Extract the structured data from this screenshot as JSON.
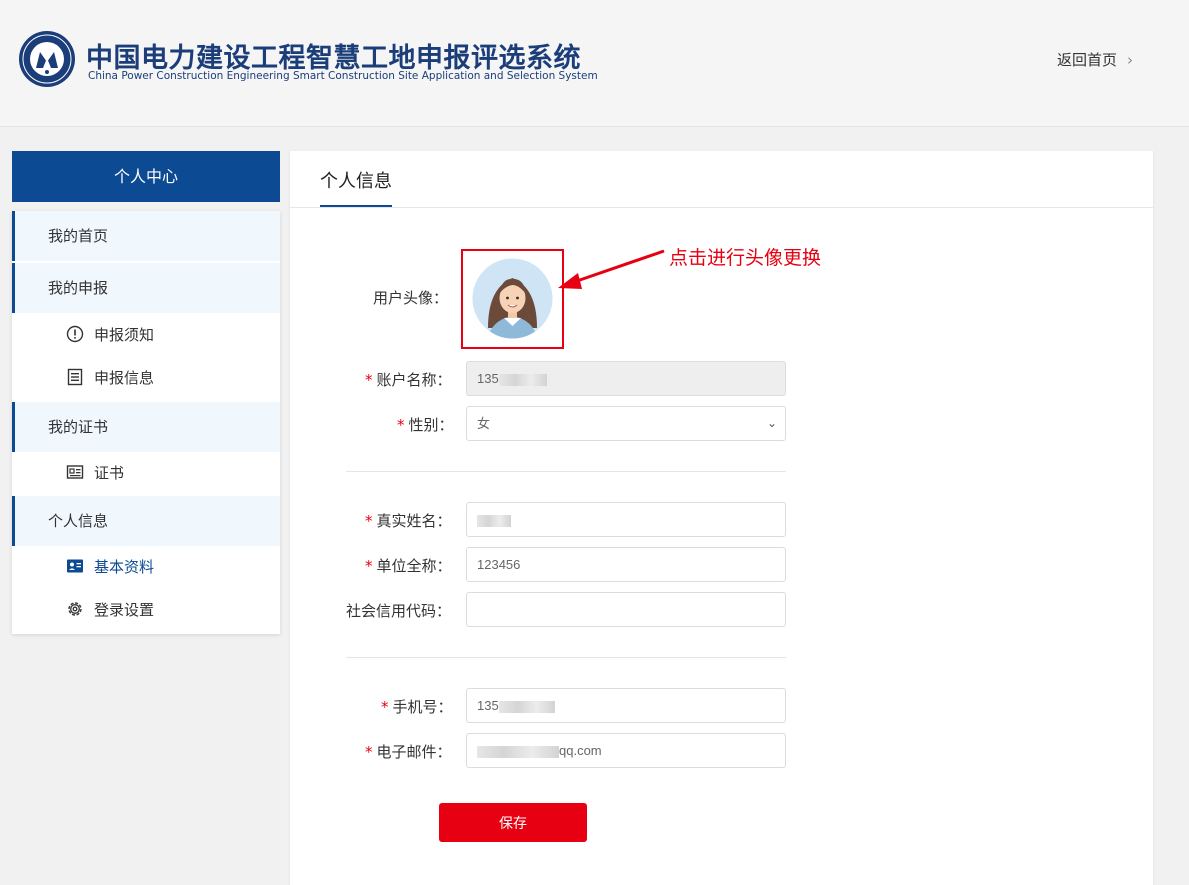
{
  "header": {
    "title_cn": "中国电力建设工程智慧工地申报评选系统",
    "title_en": "China Power Construction Engineering Smart Construction Site Application and Selection System",
    "back_label": "返回首页",
    "back_icon": "chevron-right-icon"
  },
  "sidebar": {
    "title": "个人中心",
    "groups": [
      {
        "label": "我的首页",
        "items": []
      },
      {
        "label": "我的申报",
        "items": [
          {
            "label": "申报须知",
            "icon": "info-circle-icon"
          },
          {
            "label": "申报信息",
            "icon": "document-list-icon"
          }
        ]
      },
      {
        "label": "我的证书",
        "items": [
          {
            "label": "证书",
            "icon": "certificate-icon"
          }
        ]
      },
      {
        "label": "个人信息",
        "items": [
          {
            "label": "基本资料",
            "icon": "id-card-icon",
            "active": true
          },
          {
            "label": "登录设置",
            "icon": "gear-icon"
          }
        ]
      }
    ]
  },
  "main": {
    "tab": "个人信息",
    "callout": "点击进行头像更换",
    "form": {
      "avatar_label": "用户头像：",
      "account_label": "账户名称：",
      "account_value": "135",
      "gender_label": "性别：",
      "gender_value": "女",
      "realname_label": "真实姓名：",
      "company_label": "单位全称：",
      "company_value": "123456",
      "credit_label": "社会信用代码：",
      "credit_value": "",
      "phone_label": "手机号：",
      "phone_value": "135",
      "email_label": "电子邮件：",
      "email_value": "qq.com",
      "required_mark": "*",
      "save_label": "保存"
    }
  },
  "colors": {
    "primary": "#0c4a94",
    "accent_red": "#e60012",
    "active_bg": "#f0f7fd"
  }
}
